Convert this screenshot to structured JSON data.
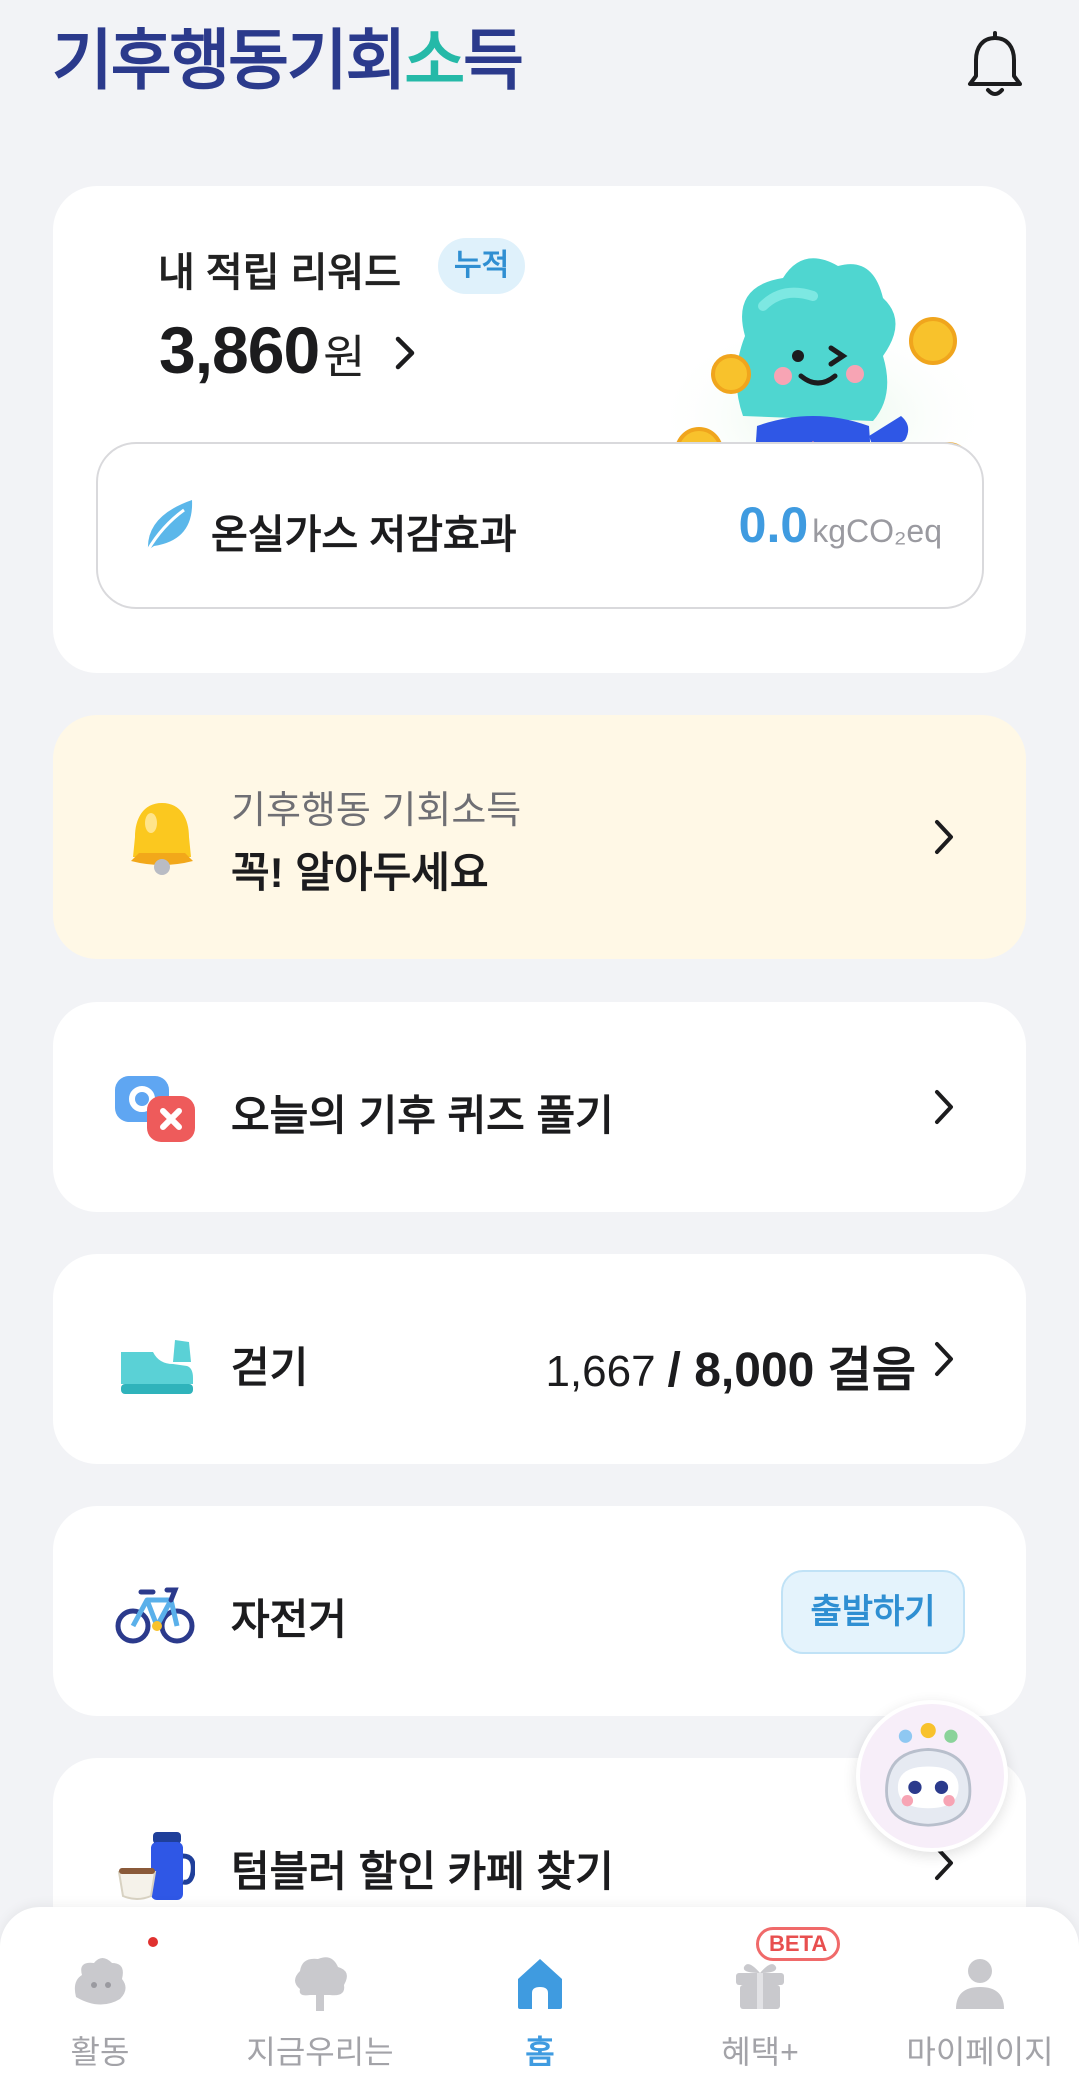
{
  "header": {
    "app_title_main": "기후행동기회",
    "app_title_accent": "소",
    "app_title_end": "득"
  },
  "reward": {
    "label": "내 적립 리워드",
    "badge": "누적",
    "amount": "3,860",
    "unit": "원"
  },
  "ghg": {
    "label": "온실가스 저감효과",
    "value": "0.0",
    "unit": "kgCO₂eq"
  },
  "notice": {
    "subtitle": "기후행동 기회소득",
    "title": "꼭! 알아두세요"
  },
  "quiz": {
    "title": "오늘의 기후 퀴즈 풀기"
  },
  "walk": {
    "title": "걷기",
    "current_steps": "1,667",
    "goal_steps": "/ 8,000 걸음",
    "current_value": 1667,
    "goal_value": 8000
  },
  "bike": {
    "title": "자전거",
    "button": "출발하기"
  },
  "tumbler": {
    "title": "텀블러 할인 카페 찾기"
  },
  "nav": {
    "items": [
      {
        "label": "활동"
      },
      {
        "label": "지금우리는"
      },
      {
        "label": "홈"
      },
      {
        "label": "혜택+"
      },
      {
        "label": "마이페이지"
      }
    ],
    "beta_badge": "BETA"
  },
  "colors": {
    "accent_blue": "#3f9be0",
    "logo_navy": "#2b3a8c",
    "notice_bg": "#fff8e6",
    "background": "#f2f3f6"
  }
}
